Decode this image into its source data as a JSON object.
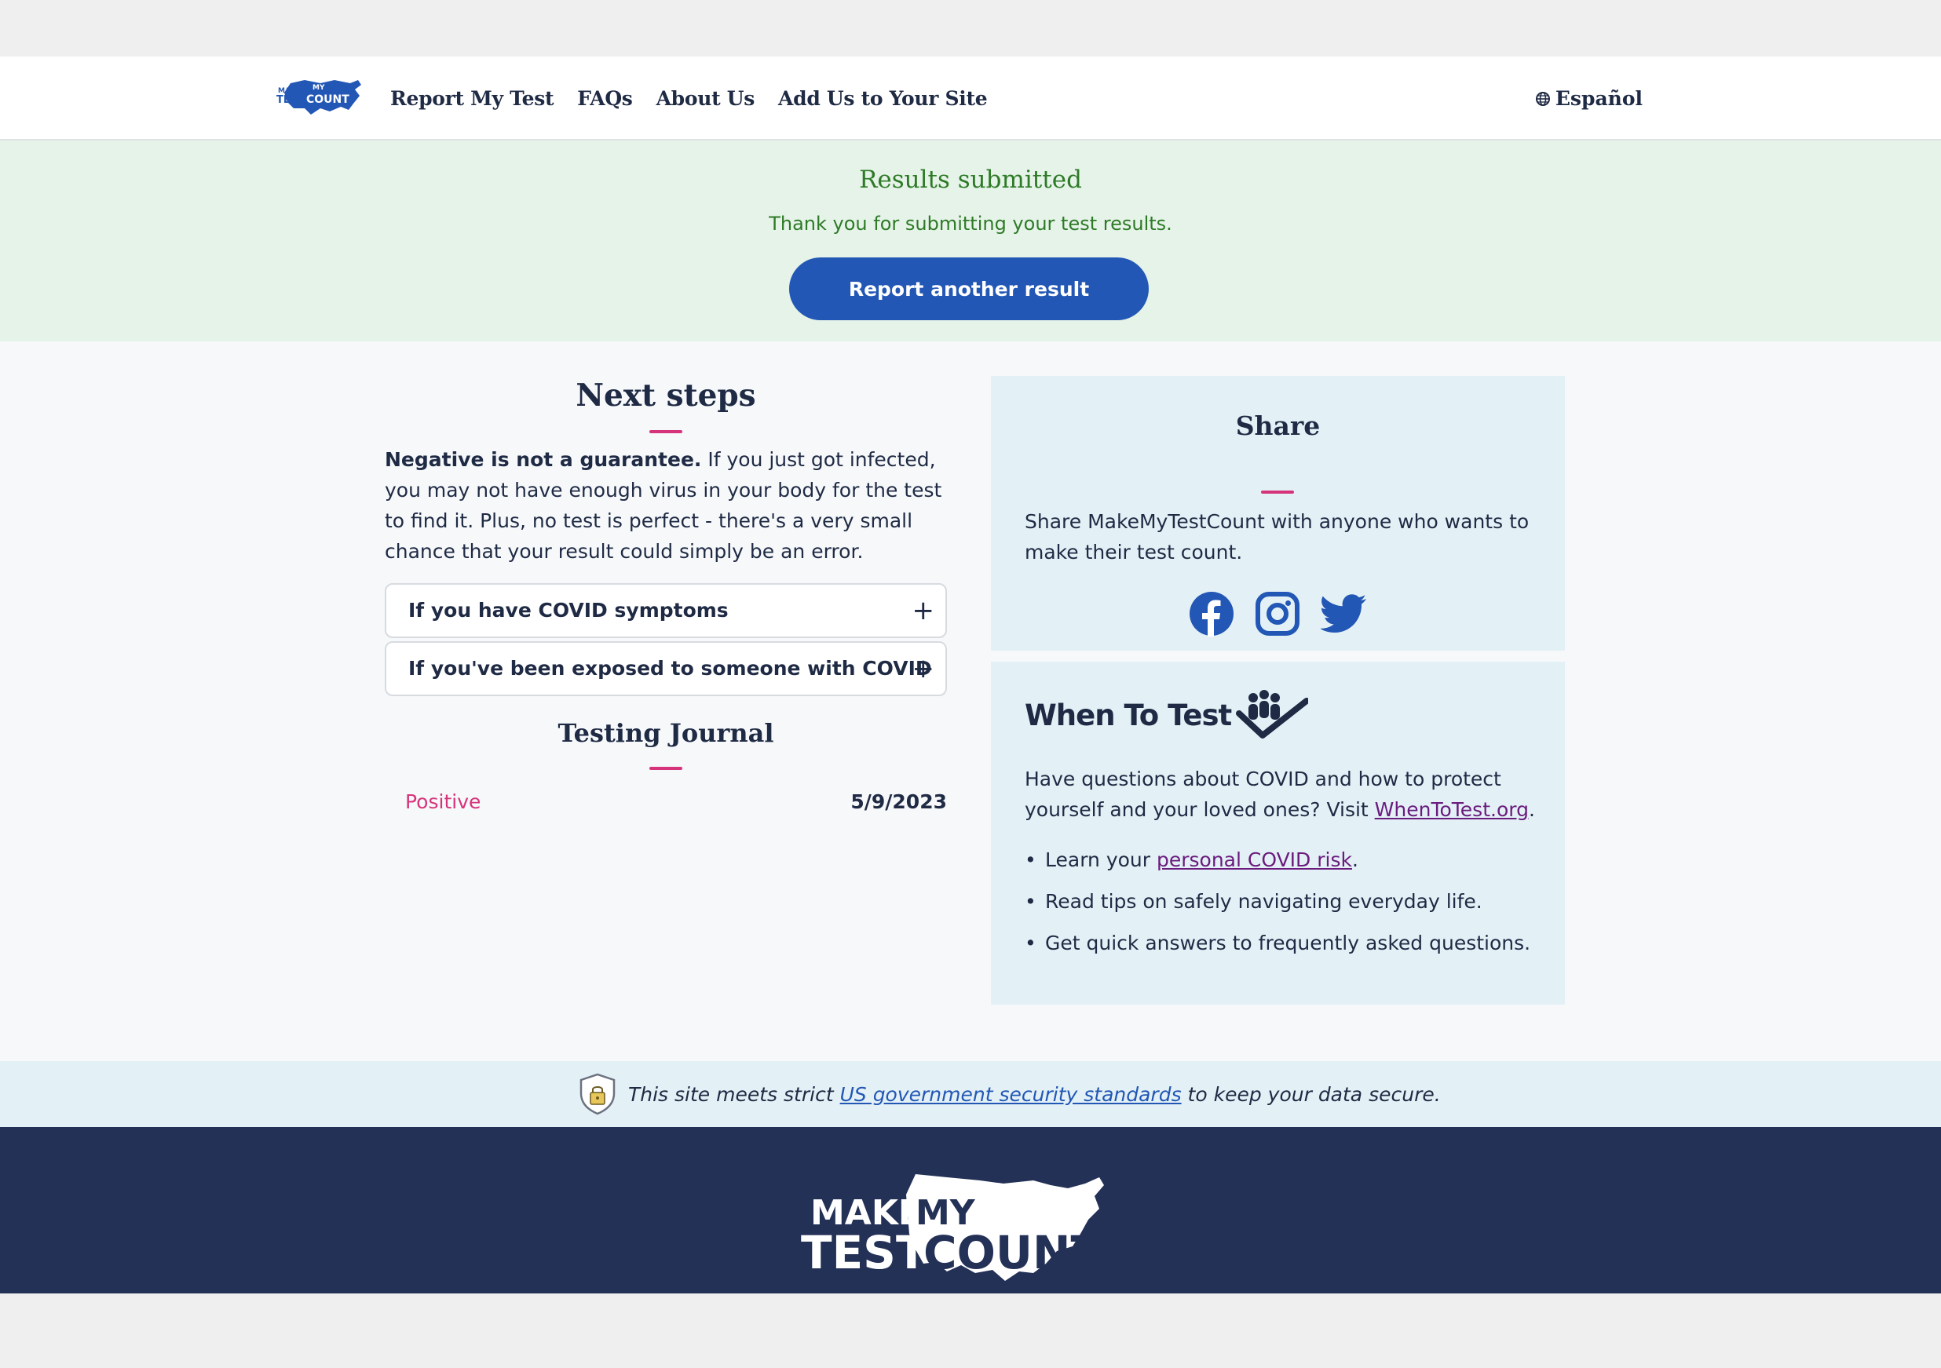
{
  "header": {
    "logo_alt": "MAKE MY TEST COUNT",
    "logo_small_make": "MAKE",
    "logo_small_my": "MY",
    "logo_small_test": "TEST",
    "logo_small_count": "COUNT",
    "nav": [
      {
        "label": "Report My Test"
      },
      {
        "label": "FAQs"
      },
      {
        "label": "About Us"
      },
      {
        "label": "Add Us to Your Site"
      }
    ],
    "language_label": "Español"
  },
  "banner": {
    "title": "Results submitted",
    "text": "Thank you for submitting your test results.",
    "button_label": "Report another result"
  },
  "next_steps": {
    "title": "Next steps",
    "para_bold": "Negative is not a guarantee.",
    "para_rest": " If you just got infected, you may not have enough virus in your body for the test to find it. Plus, no test is perfect - there's a very small chance that your result could simply be an error.",
    "accordions": [
      {
        "label": "If you have COVID symptoms"
      },
      {
        "label": "If you've been exposed to someone with COVID"
      }
    ]
  },
  "journal": {
    "title": "Testing Journal",
    "entries": [
      {
        "status": "Positive",
        "date": "5/9/2023"
      }
    ]
  },
  "share": {
    "title": "Share",
    "text": "Share MakeMyTestCount with anyone who wants to make their test count.",
    "icons": [
      "facebook-icon",
      "instagram-icon",
      "twitter-icon"
    ]
  },
  "when_to_test": {
    "logo_text": "When To Test",
    "text_before": "Have questions about COVID and how to protect yourself and your loved ones? Visit ",
    "link": "WhenToTest.org",
    "text_after": ".",
    "items": [
      {
        "before": "Learn your ",
        "link": "personal COVID risk",
        "after": "."
      },
      {
        "before": "Read tips on safely navigating everyday life.",
        "link": "",
        "after": ""
      },
      {
        "before": "Get quick answers to frequently asked questions.",
        "link": "",
        "after": ""
      }
    ]
  },
  "security": {
    "before": "This site meets strict ",
    "link": "US government security standards",
    "after": " to keep your data secure."
  },
  "footer": {
    "logo_make": "MAKE",
    "logo_my": "MY",
    "logo_test": "TEST",
    "logo_count": "COUNT"
  },
  "colors": {
    "brand_blue": "#2357b5",
    "navy": "#243157",
    "success_green": "#2e7a27",
    "accent_pink": "#d6347a"
  }
}
